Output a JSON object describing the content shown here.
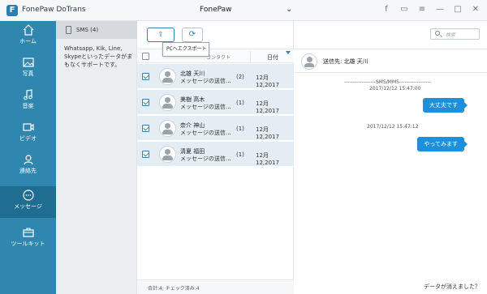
{
  "app": {
    "logo": "F",
    "title": "FonePaw DoTrans"
  },
  "device": {
    "name": "FonePaw",
    "apple_glyph": "",
    "dropdown_glyph": "⌄"
  },
  "titlebar_icons": [
    {
      "icon": "facebook-icon",
      "glyph": "f"
    },
    {
      "icon": "feedback-icon",
      "glyph": "▭"
    },
    {
      "icon": "menu-icon",
      "glyph": "≡"
    },
    {
      "icon": "minimize-icon",
      "glyph": "—"
    },
    {
      "icon": "maximize-icon",
      "glyph": "□"
    },
    {
      "icon": "close-icon",
      "glyph": "✕"
    }
  ],
  "sidebar": {
    "items": [
      {
        "label": "ホーム",
        "icon": "home-icon"
      },
      {
        "label": "写真",
        "icon": "photo-icon"
      },
      {
        "label": "音楽",
        "icon": "music-icon"
      },
      {
        "label": "ビデオ",
        "icon": "video-icon"
      },
      {
        "label": "連絡先",
        "icon": "contacts-icon"
      },
      {
        "label": "メッセージ",
        "icon": "message-icon",
        "active": true
      },
      {
        "label": "ツールキット",
        "icon": "toolkit-icon"
      }
    ]
  },
  "category": {
    "sms_label": "SMS (4)",
    "note": "Whatsapp, Kik, Line, Skypeといったデータがまもなくサポートです。"
  },
  "toolbar": {
    "export_glyph": "⇪",
    "refresh_glyph": "⟳",
    "tooltip": "PCへエクスポート"
  },
  "list": {
    "contact_header": "コンタクト",
    "date_header": "日付",
    "rows": [
      {
        "name": "北雄 天川",
        "preview": "メッセージの送信...",
        "count": "(2)",
        "date": "12月 12,2017"
      },
      {
        "name": "美樹 高木",
        "preview": "メッセージの送信...",
        "count": "(1)",
        "date": "12月 12,2017"
      },
      {
        "name": "奈介 神山",
        "preview": "メッセージの送信...",
        "count": "(1)",
        "date": "12月 12,2017"
      },
      {
        "name": "清夏 福田",
        "preview": "メッセージの送信...",
        "count": "(1)",
        "date": "12月 12,2017"
      }
    ],
    "footer": "合計:4; チェック済み:4"
  },
  "conversation": {
    "search_placeholder": "検索",
    "sender": "送信先: 北雄 天川",
    "separator": "------------------SMS/MMS------------------",
    "messages": [
      {
        "time": "2017/12/12 15:47:00",
        "text": "大丈夫です"
      },
      {
        "time": "2017/12/12 15:47:12",
        "text": "やってみます"
      }
    ],
    "lost_data": "データが消えました？"
  },
  "colors": {
    "sidebar": "#2f86ae",
    "sidebar_active": "#1f6d91",
    "selected_row": "#e4edf4",
    "bubble": "#1e8fd8"
  }
}
